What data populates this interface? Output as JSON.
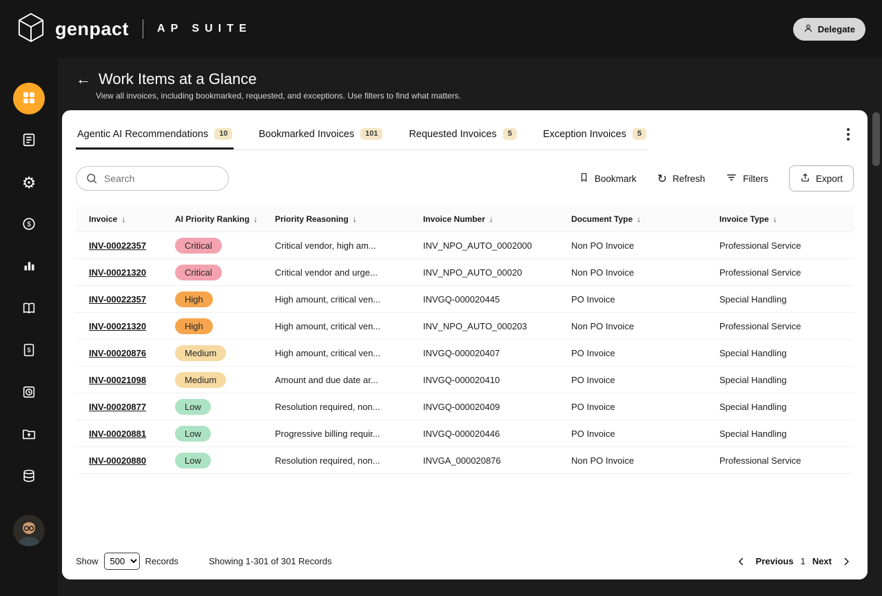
{
  "header": {
    "brand": "genpact",
    "suite": "AP SUITE",
    "delegate_label": "Delegate"
  },
  "sidebar": {
    "icons": [
      "apps",
      "tasks-document",
      "settings-gear",
      "payments-dollar",
      "analytics-bar-chart",
      "ledger-book",
      "invoice-dollar",
      "history-clock",
      "upload-folder",
      "data-stack"
    ],
    "active_icon": "apps"
  },
  "page": {
    "title": "Work Items at a Glance",
    "subtitle": "View all invoices, including bookmarked, requested, and exceptions. Use filters to find what matters."
  },
  "tabs": [
    {
      "label": "Agentic AI Recommendations",
      "count": "10",
      "active": true
    },
    {
      "label": "Bookmarked Invoices",
      "count": "101",
      "active": false
    },
    {
      "label": "Requested Invoices",
      "count": "5",
      "active": false
    },
    {
      "label": "Exception Invoices",
      "count": "5",
      "active": false
    }
  ],
  "toolbar": {
    "search_placeholder": "Search",
    "bookmark_label": "Bookmark",
    "refresh_label": "Refresh",
    "filters_label": "Filters",
    "export_label": "Export"
  },
  "table": {
    "columns": [
      "Invoice",
      "AI Priority Ranking",
      "Priority Reasoning",
      "Invoice Number",
      "Document Type",
      "Invoice Type"
    ],
    "rows": [
      {
        "invoice": "INV-00022357",
        "priority": "Critical",
        "reason": "Critical vendor, high am...",
        "invoice_number": "INV_NPO_AUTO_0002000",
        "document_type": "Non PO Invoice",
        "invoice_type": "Professional Service"
      },
      {
        "invoice": "INV-00021320",
        "priority": "Critical",
        "reason": "Critical vendor and urge...",
        "invoice_number": "INV_NPO_AUTO_00020",
        "document_type": "Non PO Invoice",
        "invoice_type": "Professional Service"
      },
      {
        "invoice": "INV-00022357",
        "priority": "High",
        "reason": "High amount, critical ven...",
        "invoice_number": "INVGQ-000020445",
        "document_type": "PO Invoice",
        "invoice_type": "Special Handling"
      },
      {
        "invoice": "INV-00021320",
        "priority": "High",
        "reason": "High amount, critical ven...",
        "invoice_number": "INV_NPO_AUTO_000203",
        "document_type": "Non PO Invoice",
        "invoice_type": "Professional Service"
      },
      {
        "invoice": "INV-00020876",
        "priority": "Medium",
        "reason": "High amount, critical ven...",
        "invoice_number": "INVGQ-000020407",
        "document_type": "PO Invoice",
        "invoice_type": "Special Handling"
      },
      {
        "invoice": "INV-00021098",
        "priority": "Medium",
        "reason": "Amount and due date ar...",
        "invoice_number": "INVGQ-000020410",
        "document_type": "PO Invoice",
        "invoice_type": "Special Handling"
      },
      {
        "invoice": "INV-00020877",
        "priority": "Low",
        "reason": "Resolution required, non...",
        "invoice_number": "INVGQ-000020409",
        "document_type": "PO Invoice",
        "invoice_type": "Special Handling"
      },
      {
        "invoice": "INV-00020881",
        "priority": "Low",
        "reason": "Progressive billing requir...",
        "invoice_number": "INVGQ-000020446",
        "document_type": "PO Invoice",
        "invoice_type": "Special Handling"
      },
      {
        "invoice": "INV-00020880",
        "priority": "Low",
        "reason": "Resolution required, non...",
        "invoice_number": "INVGA_000020876",
        "document_type": "Non PO Invoice",
        "invoice_type": "Professional Service"
      }
    ]
  },
  "footer": {
    "show_label": "Show",
    "records_per_page": "500",
    "records_label": "Records",
    "summary": "Showing 1-301 of 301 Records",
    "previous_label": "Previous",
    "page": "1",
    "next_label": "Next"
  },
  "colors": {
    "accent_orange": "#FFA726",
    "pill_critical": "#f4a2b0",
    "pill_high": "#f6a54d",
    "pill_medium": "#f6daa2",
    "pill_low": "#ace3c4",
    "tab_badge_bg": "#f4e6c4",
    "header_bg": "#151515",
    "page_bg": "#1c1c1c"
  }
}
